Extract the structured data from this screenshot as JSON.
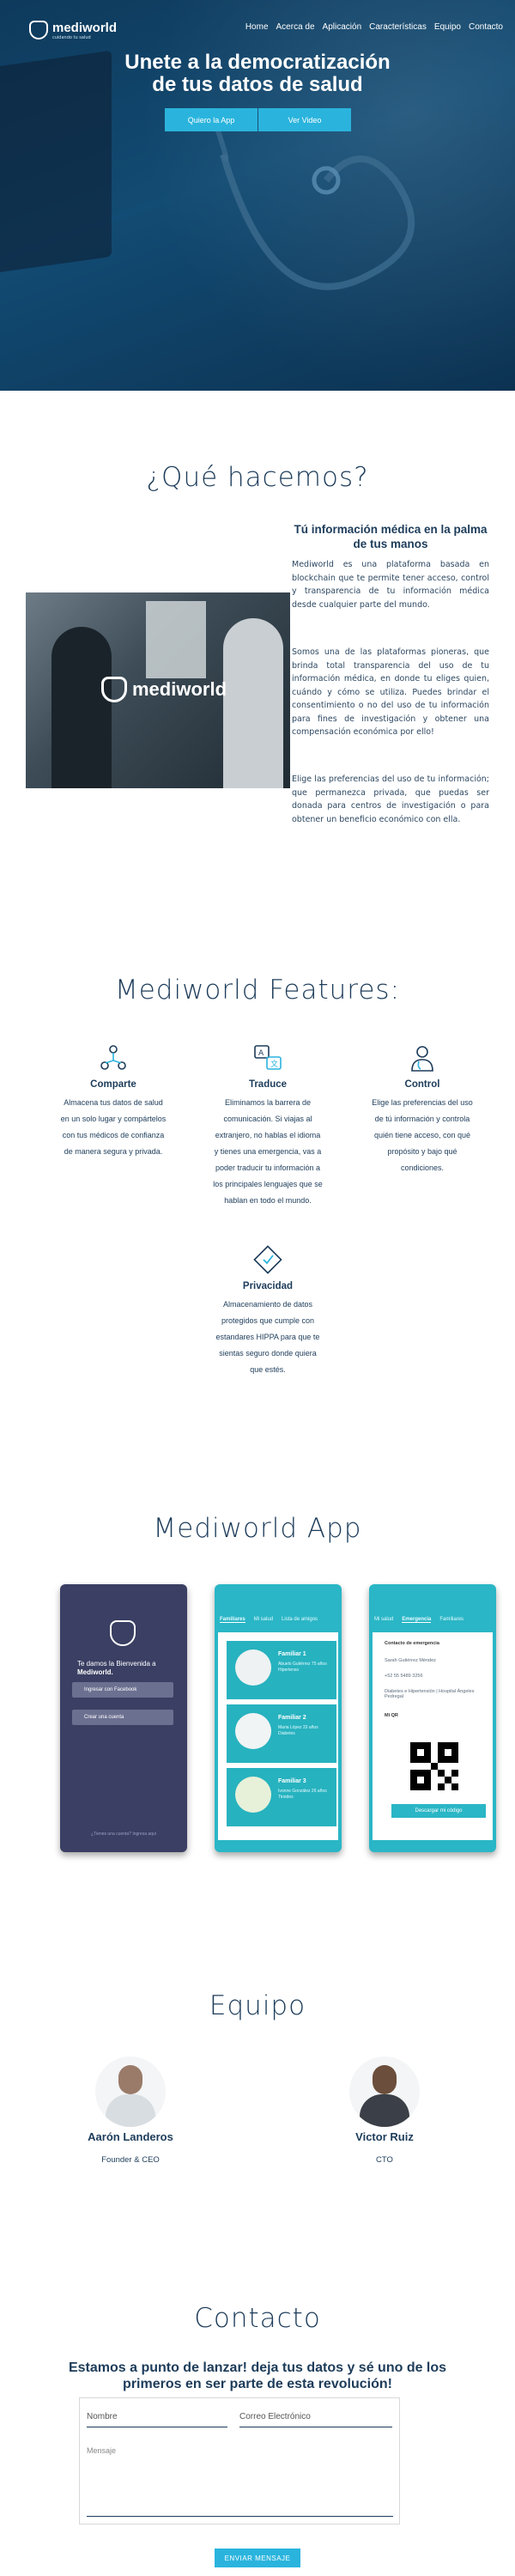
{
  "brand": {
    "name": "mediworld",
    "tagline": "cuidando tu salud"
  },
  "nav": {
    "items": [
      "Home",
      "Acerca de",
      "Aplicación",
      "Características",
      "Equipo",
      "Contacto"
    ]
  },
  "hero": {
    "title_line1": "Unete a la democratización",
    "title_line2": "de tus datos de salud",
    "btn_app": "Quiero la App",
    "btn_video": "Ver Video"
  },
  "what": {
    "title": "¿Qué hacemos?",
    "subtitle": "Tú información médica en la palma de tus manos",
    "p1": "Mediworld es una plataforma basada en blockchain que te permite tener acceso, control y transparencia de tu información médica desde cualquier parte del mundo.",
    "p2": "Somos una de las plataformas pioneras, que brinda total transparencia del uso de tu información médica, en donde tu eliges quien, cuándo y cómo se utiliza. Puedes brindar el consentimiento o no del uso de tu información para fines de investigación y obtener una compensación económica por ello!",
    "p3": "Elige las preferencias del uso de tu información; que permanezca privada, que puedas ser donada para centros de investigación o para obtener un beneficio económico con ella.",
    "image_logo": "mediworld"
  },
  "features": {
    "title": "Mediworld Features:",
    "items": [
      {
        "icon": "share-network-icon",
        "title": "Comparte",
        "text": "Almacena tus datos de salud en un solo lugar y compártelos con tus médicos de confianza de manera segura y privada."
      },
      {
        "icon": "translate-icon",
        "title": "Traduce",
        "text": "Eliminamos la barrera de comunicación. Si viajas al extranjero, no hablas el idioma y tienes una emergencia, vas a poder traducir tu información a los principales lenguajes que se hablan en todo el mundo."
      },
      {
        "icon": "doctor-icon",
        "title": "Control",
        "text": "Elige las preferencias del uso de tú información y controla quién tiene acceso, con qué propósito y bajo qué condiciones."
      },
      {
        "icon": "privacy-shield-icon",
        "title": "Privacidad",
        "text": "Almacenamiento de datos protegidos que cumple con estandares HIPPA para que te sientas seguro donde quiera que estés."
      }
    ]
  },
  "app": {
    "title": "Mediworld App",
    "phone1": {
      "welcome": "Te damos la Bienvenida a",
      "brand": "Mediworld.",
      "facebook": "Ingresar con Facebook",
      "email": "Crear una cuenta",
      "footer": "¿Tienes una cuenta? Ingresa aqui"
    },
    "phone2": {
      "tabs": [
        "Familiares",
        "Mi salud",
        "Lista de amigos"
      ],
      "cards": [
        {
          "name": "Familiar 1",
          "info": "Abuelo Gutiérrez 75 años Hipertenso"
        },
        {
          "name": "Familiar 2",
          "info": "Maria López 33 años Diabetes"
        },
        {
          "name": "Familiar 3",
          "info": "Ivonne González 26 años Tiroides"
        }
      ]
    },
    "phone3": {
      "tabs": [
        "Mi salud",
        "Emergencia",
        "Familiares"
      ],
      "heading": "Contacto de emergencia",
      "lines": [
        "Sarah Gutiérrez Méndez",
        "+52 55 5489 3256",
        "Diabetes e Hipertensión | Hospital Ángeles Pedregal"
      ],
      "qr_label": "Mi QR",
      "button": "Descargar mi código"
    }
  },
  "team": {
    "title": "Equipo",
    "members": [
      {
        "name": "Aarón Landeros",
        "role": "Founder & CEO"
      },
      {
        "name": "Victor Ruiz",
        "role": "CTO"
      }
    ]
  },
  "contact": {
    "title": "Contacto",
    "subtitle": "Estamos a punto de lanzar! deja tus datos y sé uno de los primeros en ser parte de esta revolución!",
    "name_placeholder": "Nombre",
    "email_placeholder": "Correo Electrónico",
    "message_placeholder": "Mensaje",
    "send": "ENVIAR MENSAJE"
  },
  "colors": {
    "accent": "#2ab4dd",
    "navy": "#1d3c5a",
    "hero": "#124b73",
    "teal": "#2ab6c6"
  }
}
